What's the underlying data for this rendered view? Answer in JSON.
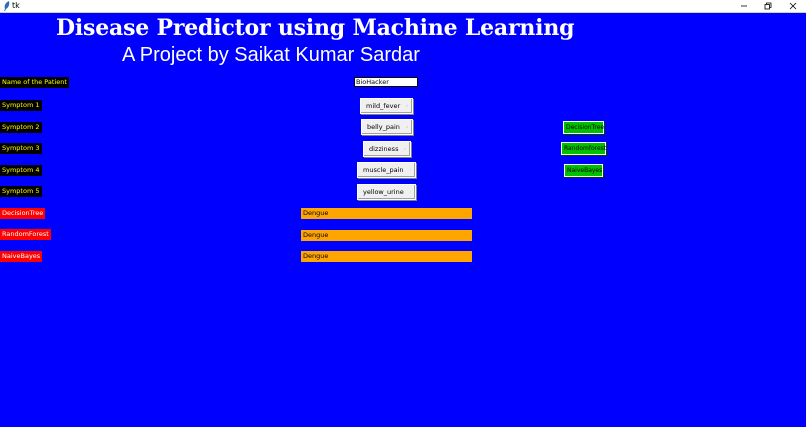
{
  "window": {
    "title": "tk",
    "icon": "feather-icon"
  },
  "header": {
    "title": "Disease Predictor using Machine Learning",
    "subtitle": "A Project by Saikat Kumar Sardar"
  },
  "patient": {
    "label": "Name of the Patient",
    "value": "BioHacker"
  },
  "symptoms": [
    {
      "label": "Symptom 1",
      "value": "mild_fever"
    },
    {
      "label": "Symptom 2",
      "value": "belly_pain"
    },
    {
      "label": "Symptom 3",
      "value": "dizziness"
    },
    {
      "label": "Symptom 4",
      "value": "muscle_pain"
    },
    {
      "label": "Symptom 5",
      "value": "yellow_urine"
    }
  ],
  "results": [
    {
      "label": "DecisionTree",
      "value": "Dengue"
    },
    {
      "label": "RandomForest",
      "value": "Dengue"
    },
    {
      "label": "NaiveBayes",
      "value": "Dengue"
    }
  ],
  "buttons": {
    "decision_tree": "DecisionTree",
    "random_forest": "Randomforest",
    "naive_bayes": "NaiveBayes"
  },
  "colors": {
    "background": "#0000ff",
    "label_bg": "#000000",
    "label_fg": "#ffff00",
    "result_label_bg": "#ff0000",
    "result_value_bg": "#ffa500",
    "button_bg": "#00c000"
  }
}
